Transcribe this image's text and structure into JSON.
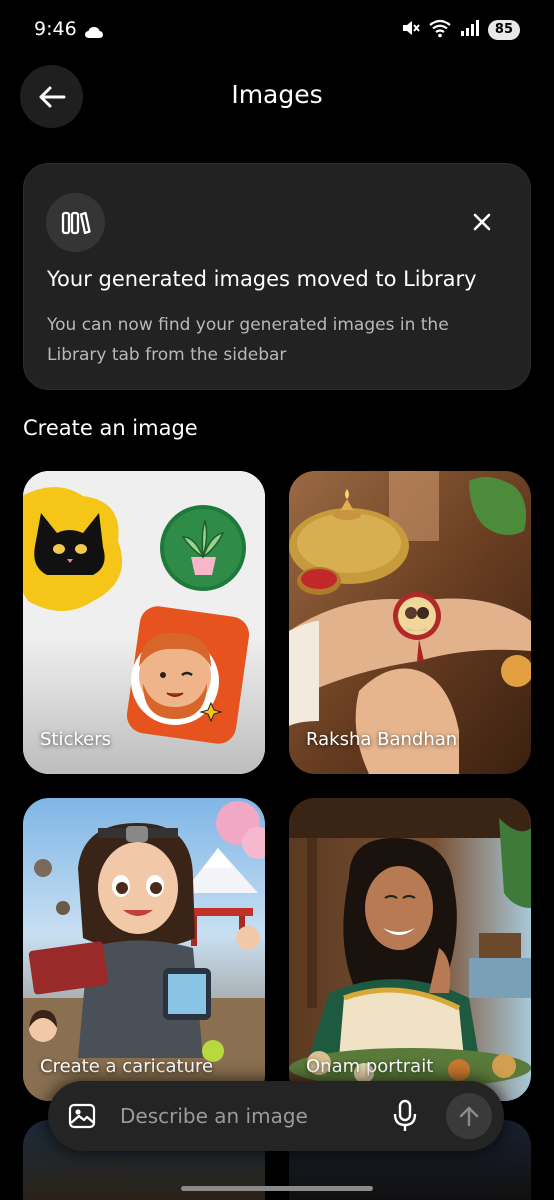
{
  "status_bar": {
    "time": "9:46",
    "battery": "85",
    "icons": [
      "cloud-icon",
      "mute-icon",
      "wifi-icon",
      "signal-icon",
      "battery-icon"
    ]
  },
  "header": {
    "title": "Images",
    "back_icon": "back-arrow-icon"
  },
  "banner": {
    "icon": "library-icon",
    "title": "Your generated images moved to Library",
    "body": "You can now find your generated images in the Library tab from the sidebar",
    "close_icon": "close-icon"
  },
  "section": {
    "title": "Create an image"
  },
  "cards": [
    {
      "label": "Stickers"
    },
    {
      "label": "Raksha Bandhan"
    },
    {
      "label": "Create a caricature"
    },
    {
      "label": "Onam portrait"
    }
  ],
  "composer": {
    "placeholder": "Describe an image",
    "image_icon": "image-icon",
    "mic_icon": "mic-icon",
    "send_icon": "send-arrow-icon"
  }
}
